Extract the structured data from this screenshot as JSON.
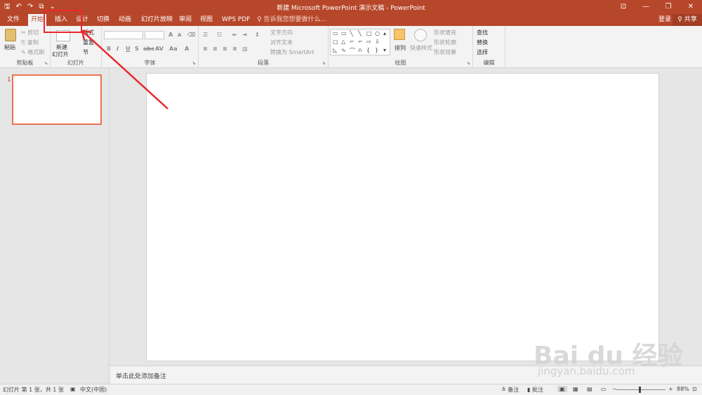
{
  "titlebar": {
    "title": "新建 Microsoft PowerPoint 演示文稿 - PowerPoint",
    "qat": {
      "save": "🖫",
      "undo": "↶",
      "redo": "↷",
      "present": "⧉",
      "more": "⌄"
    },
    "window_controls": {
      "ribbon_options": "⊡",
      "minimize": "—",
      "restore": "❐",
      "close": "✕"
    }
  },
  "tabs": {
    "file": "文件",
    "home": "开始",
    "insert": "插入",
    "design": "设计",
    "transitions": "切换",
    "animations": "动画",
    "slideshow": "幻灯片放映",
    "review": "审阅",
    "view": "视图",
    "wps_pdf": "WPS PDF",
    "tell_me": "♀ 告诉我您想要做什么...",
    "sign_in": "登录",
    "share": "♀ 共享"
  },
  "ribbon": {
    "clipboard": {
      "label": "剪贴板",
      "paste": "粘贴",
      "cut": "✂ 剪切",
      "copy": "⎘ 复制",
      "format_painter": "✎ 格式刷"
    },
    "slides": {
      "label": "幻灯片",
      "new_slide": "新建",
      "new_slide_line2": "幻灯片",
      "layout": "版式",
      "reset": "重置",
      "section": "节"
    },
    "font": {
      "label": "字体",
      "bold": "B",
      "italic": "I",
      "underline": "U",
      "strike": "S",
      "abc": "abc",
      "spacing": "AV",
      "case": "Aa",
      "color": "A",
      "grow": "A",
      "shrink": "A",
      "clear": "⌫"
    },
    "paragraph": {
      "label": "段落",
      "text_direction": "文字方向",
      "align_text": "对齐文本",
      "smartart": "转换为 SmartArt"
    },
    "drawing": {
      "label": "绘图",
      "arrange": "排列",
      "quick_styles": "快速样式",
      "shape_fill": "形状填充",
      "shape_outline": "形状轮廓",
      "shape_effects": "形状效果"
    },
    "editing": {
      "label": "编辑",
      "find": "查找",
      "replace": "替换",
      "select": "选择"
    }
  },
  "slides_panel": {
    "slide_number": "1"
  },
  "notes": {
    "placeholder": "单击此处添加备注"
  },
  "status": {
    "slide_info": "幻灯片 第 1 张，共 1 张",
    "language": "中文(中国)",
    "notes_btn": "≜ 备注",
    "comments_btn": "▮ 批注",
    "zoom": "88%"
  },
  "watermark": {
    "logo": "Bai du 经验",
    "url": "jingyan.baidu.com"
  },
  "colors": {
    "accent": "#b7472a",
    "annotation": "#e8292c",
    "thumb_border": "#e8744f"
  }
}
